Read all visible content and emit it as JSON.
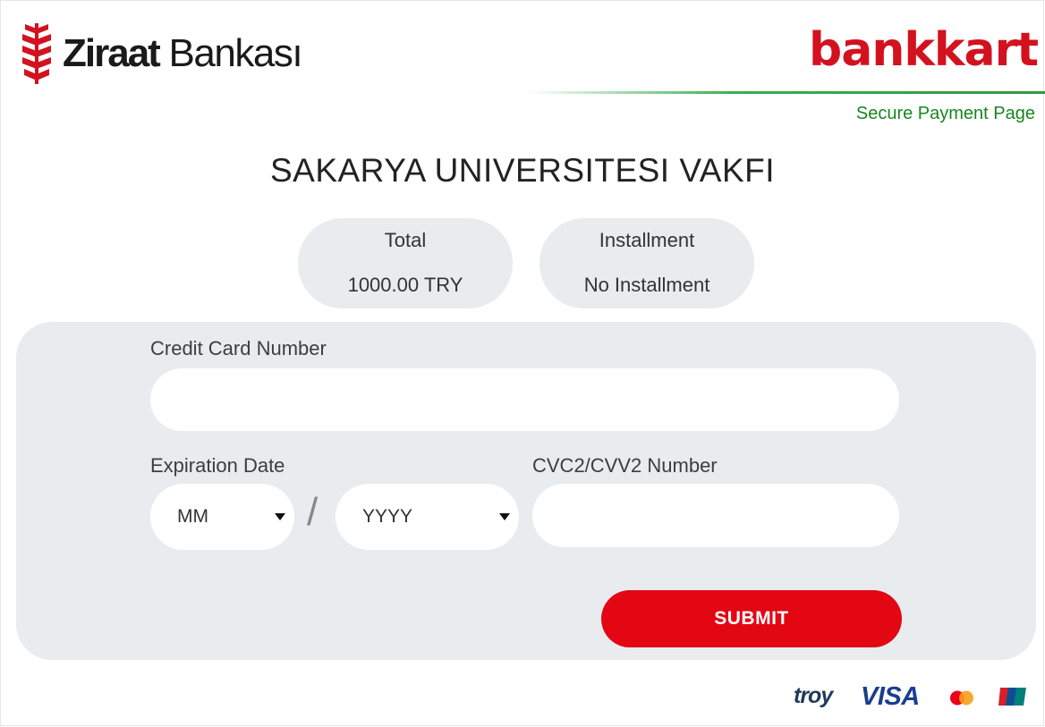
{
  "header": {
    "bank_name_bold": "Ziraat",
    "bank_name_rest": " Bankası",
    "brand_logo": "bankkart",
    "secure_label": "Secure Payment Page"
  },
  "merchant": {
    "name": "SAKARYA UNIVERSITESI VAKFI"
  },
  "summary": {
    "total_label": "Total",
    "total_value": "1000.00 TRY",
    "installment_label": "Installment",
    "installment_value": "No Installment"
  },
  "form": {
    "card_number_label": "Credit Card Number",
    "card_number_value": "",
    "expiration_label": "Expiration Date",
    "month_selected": "MM",
    "year_selected": "YYYY",
    "separator": "/",
    "cvv_label": "CVC2/CVV2 Number",
    "cvv_value": "",
    "submit_label": "SUBMIT"
  },
  "card_brands": {
    "troy": "troy",
    "visa": "VISA",
    "mastercard": "mastercard",
    "unionpay": "UnionPay"
  },
  "colors": {
    "primary_red": "#e30613",
    "secure_green": "#18861f",
    "panel_gray": "#e8ecee",
    "visa_blue": "#1a3d8f"
  }
}
